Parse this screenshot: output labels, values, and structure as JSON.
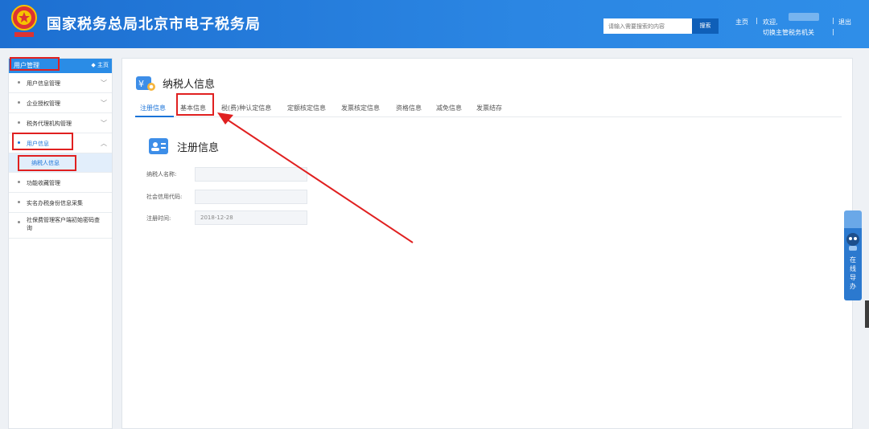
{
  "header": {
    "site_title": "国家税务总局北京市电子税务局",
    "search_placeholder": "请输入需要搜索的内容",
    "search_button": "搜索",
    "home_link": "主页",
    "welcome": "欢迎,",
    "switch_org": "切换主管税务机关",
    "logout": "退出",
    "separator": "|"
  },
  "sidebar": {
    "title": "用户管理",
    "home": "主页",
    "items": [
      {
        "label": "用户信息管理"
      },
      {
        "label": "企业授权管理"
      },
      {
        "label": "税务代理机构管理"
      },
      {
        "label": "用户信息"
      },
      {
        "label": "纳税人信息"
      },
      {
        "label": "功能收藏管理"
      },
      {
        "label": "实名办税身份信息采集"
      },
      {
        "label": "社保费管理客户端初始密码查询"
      }
    ]
  },
  "main": {
    "page_title": "纳税人信息",
    "tabs": [
      "注册信息",
      "基本信息",
      "税(费)种认定信息",
      "定额核定信息",
      "发票核定信息",
      "资格信息",
      "减免信息",
      "发票结存"
    ],
    "section_title": "注册信息",
    "fields": [
      {
        "label": "纳税人名称:",
        "value": ""
      },
      {
        "label": "社会信用代码:",
        "value": ""
      },
      {
        "label": "注册时间:",
        "value": "2018-12-28"
      }
    ]
  },
  "float_service": {
    "text": "在线导办"
  },
  "colors": {
    "header_blue": "#2b86e3",
    "accent": "#1a73d8",
    "highlight_red": "#e02020"
  }
}
